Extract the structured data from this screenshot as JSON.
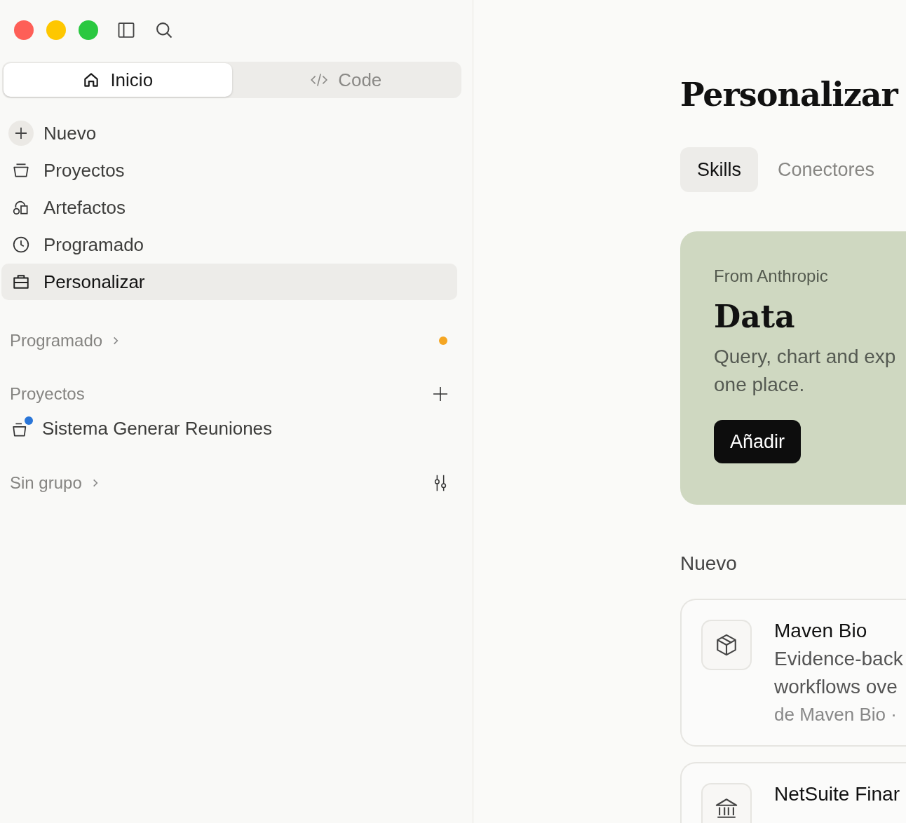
{
  "sidebar": {
    "modes": [
      {
        "label": "Inicio",
        "kind": "home",
        "selected": true
      },
      {
        "label": "Code",
        "kind": "code",
        "selected": false
      }
    ],
    "nav": [
      {
        "label": "Nuevo",
        "kind": "plus",
        "selected": false
      },
      {
        "label": "Proyectos",
        "kind": "tray",
        "selected": false
      },
      {
        "label": "Artefactos",
        "kind": "shapes",
        "selected": false
      },
      {
        "label": "Programado",
        "kind": "clock",
        "selected": false
      },
      {
        "label": "Personalizar",
        "kind": "briefcase",
        "selected": true
      }
    ],
    "sections": [
      {
        "title": "Programado",
        "expanded": false,
        "kind": "status",
        "color": "#f5a623"
      },
      {
        "title": "Proyectos",
        "kind": "addable",
        "items": [
          {
            "label": "Sistema Generar Reuniones",
            "color": "#2a76d8"
          }
        ]
      },
      {
        "title": "Sin grupo",
        "expanded": false,
        "kind": "filterable"
      }
    ]
  },
  "main": {
    "title": "Personalizar",
    "tabs": [
      {
        "label": "Skills",
        "selected": true
      },
      {
        "label": "Conectores",
        "selected": false
      }
    ],
    "featured": {
      "source": "From Anthropic",
      "name": "Data",
      "description_lines": [
        "Query, chart and exp",
        "one place."
      ],
      "button": "Añadir"
    },
    "section_title": "Nuevo",
    "items": [
      {
        "name": "Maven Bio",
        "kind": "package",
        "description_lines": [
          "Evidence-back",
          "workflows ove"
        ],
        "meta": "de Maven Bio ·"
      },
      {
        "name": "NetSuite Finar",
        "kind": "bank"
      }
    ]
  }
}
